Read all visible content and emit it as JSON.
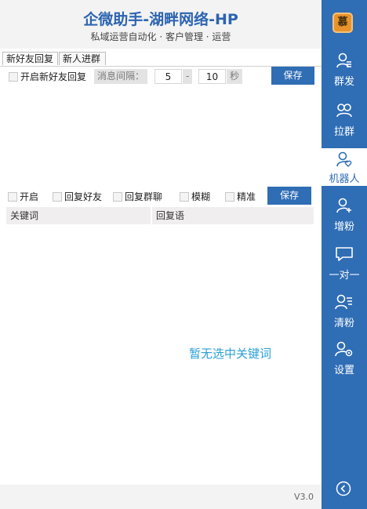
{
  "header": {
    "title": "企微助手-湖畔网络-HP",
    "subtitle": "私域运营自动化 · 客户管理 · 运营"
  },
  "tabs": [
    {
      "label": "新好友回复"
    },
    {
      "label": "新人进群"
    }
  ],
  "settings": {
    "enable_label": "开启新好友回复",
    "interval_label": "消息间隔：",
    "interval_min": "5",
    "separator": "-",
    "interval_max": "10",
    "unit": "秒",
    "save_label": "保存"
  },
  "filters": {
    "items": [
      "开启",
      "回复好友",
      "回复群聊",
      "模糊",
      "精准"
    ],
    "save_label": "保存"
  },
  "table": {
    "columns": [
      "关键词",
      "回复语"
    ],
    "empty_text": "暂无选中关键词"
  },
  "footer": {
    "version": "V3.0"
  },
  "sidebar": {
    "logo_text": "慕",
    "items": [
      {
        "label": "群发",
        "icon": "broadcast-icon"
      },
      {
        "label": "拉群",
        "icon": "group-icon"
      },
      {
        "label": "机器人",
        "icon": "robot-icon",
        "active": true
      },
      {
        "label": "增粉",
        "icon": "add-user-icon"
      },
      {
        "label": "一对一",
        "icon": "chat-icon"
      },
      {
        "label": "清粉",
        "icon": "clean-user-icon"
      },
      {
        "label": "设置",
        "icon": "settings-icon"
      }
    ],
    "collapse_icon": "chevron-left-icon"
  }
}
